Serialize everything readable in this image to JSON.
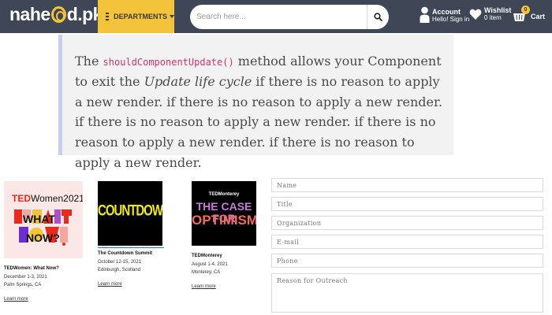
{
  "header": {
    "logo_left": "nahe",
    "logo_right": "d.pk",
    "departments_label": "DEPARTMENTS",
    "search_placeholder": "Search here...",
    "account_label": "Account",
    "account_sub": "Hello! Sign in",
    "wishlist_label": "Wishlist",
    "wishlist_sub": "0 item",
    "cart_count": "0",
    "cart_label": "Cart",
    "colors": {
      "bar": "#3f4756",
      "accent": "#f3c33b"
    }
  },
  "quote": {
    "text_before": "The ",
    "code": "shouldComponentUpdate()",
    "text_mid": " method allows your Component to exit the ",
    "emphasis": "Update life cycle",
    "text_after": " if there is no reason to apply a new render. if there is no reason to apply a new render. if there is no reason to apply a new render. if there is no reason to apply a new render. if there is no reason to apply a new render."
  },
  "events": [
    {
      "thumb_ted": "TED",
      "thumb_name": "Women",
      "thumb_year": "2021",
      "thumb_lines": [
        "WHAT",
        "NOW?"
      ],
      "title": "TEDWomen: What Now?",
      "date": "December 1-3, 2021",
      "location": "Palm Springs, CA",
      "link": "Learn more"
    },
    {
      "thumb_text": "COUNTDOWN",
      "title": "The Countdown Summit",
      "date": "October 12-15, 2021",
      "location": "Edinburgh, Scotland",
      "link": "Learn more"
    },
    {
      "thumb_head": "TEDMonterey",
      "thumb_line1": "THE CASE FOR",
      "thumb_line2": "OPTIMISM",
      "title": "TEDMonterey",
      "date": "August 1-4, 2021",
      "location": "Monterey, CA",
      "link": "Learn more"
    }
  ],
  "form": {
    "name_placeholder": "Name",
    "title_placeholder": "Title",
    "organization_placeholder": "Organization",
    "email_placeholder": "E-mail",
    "phone_placeholder": "Phone",
    "reason_placeholder": "Reason for Outreach"
  }
}
